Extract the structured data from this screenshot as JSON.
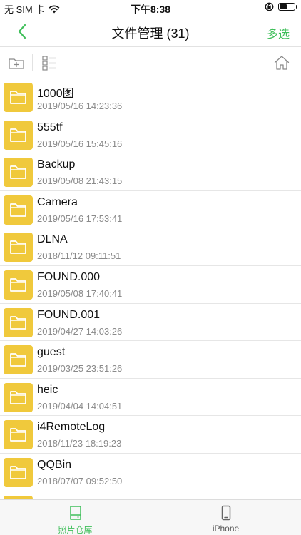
{
  "status": {
    "carrier": "无 SIM 卡",
    "time": "下午8:38",
    "battery_level": 0.55
  },
  "nav": {
    "title": "文件管理 (31)",
    "multi_select_label": "多选"
  },
  "files": [
    {
      "name": "1000图",
      "date": "2019/05/16 14:23:36"
    },
    {
      "name": "555tf",
      "date": "2019/05/16 15:45:16"
    },
    {
      "name": "Backup",
      "date": "2019/05/08 21:43:15"
    },
    {
      "name": "Camera",
      "date": "2019/05/16 17:53:41"
    },
    {
      "name": "DLNA",
      "date": "2018/11/12 09:11:51"
    },
    {
      "name": "FOUND.000",
      "date": "2019/05/08 17:40:41"
    },
    {
      "name": "FOUND.001",
      "date": "2019/04/27 14:03:26"
    },
    {
      "name": "guest",
      "date": "2019/03/25 23:51:26"
    },
    {
      "name": "heic",
      "date": "2019/04/04 14:04:51"
    },
    {
      "name": "i4RemoteLog",
      "date": "2018/11/23 18:19:23"
    },
    {
      "name": "QQBin",
      "date": "2018/07/07 09:52:50"
    },
    {
      "name": "",
      "date": ""
    }
  ],
  "tabs": [
    {
      "label": "照片仓库",
      "active": true
    },
    {
      "label": "iPhone",
      "active": false
    }
  ],
  "colors": {
    "accent": "#3fbf5a",
    "folder": "#f0c93c",
    "icon_gray": "#8a8a8a"
  }
}
